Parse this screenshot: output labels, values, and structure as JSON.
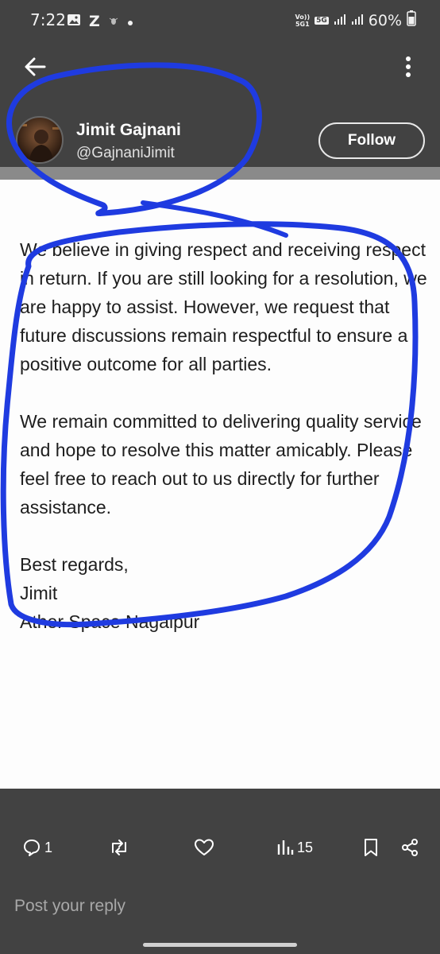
{
  "status_bar": {
    "time": "7:22",
    "net_top": "Vo))",
    "net_bottom": "5G1",
    "net_badge": "5G",
    "battery": "60%",
    "left_icons": [
      "image-icon",
      "z-notification-icon",
      "bug-icon",
      "dot-icon"
    ],
    "right_icons": [
      "signal-icon",
      "signal-icon",
      "battery-icon"
    ]
  },
  "author": {
    "display_name": "Jimit Gajnani",
    "handle": "@GajnaniJimit",
    "follow_label": "Follow"
  },
  "post": {
    "paragraphs": [
      "We believe in giving respect and receiving respect in return. If you are still looking for a resolution, we are happy to assist. However, we request that future discussions remain respectful to ensure a positive outcome for all parties.",
      "We remain committed to delivering quality service and hope to resolve this matter amicably. Please feel free to reach out to us directly for further assistance."
    ],
    "signoff": "Best regards,",
    "signer": "Jimit",
    "signer_org": "Ather Space Nagalpur"
  },
  "actions": {
    "replies_count": "1",
    "views_count": "15"
  },
  "reply": {
    "placeholder": "Post your reply"
  },
  "colors": {
    "background": "#424242",
    "content_bg": "#fdfdfd",
    "annotation_blue": "#1f3be0"
  }
}
